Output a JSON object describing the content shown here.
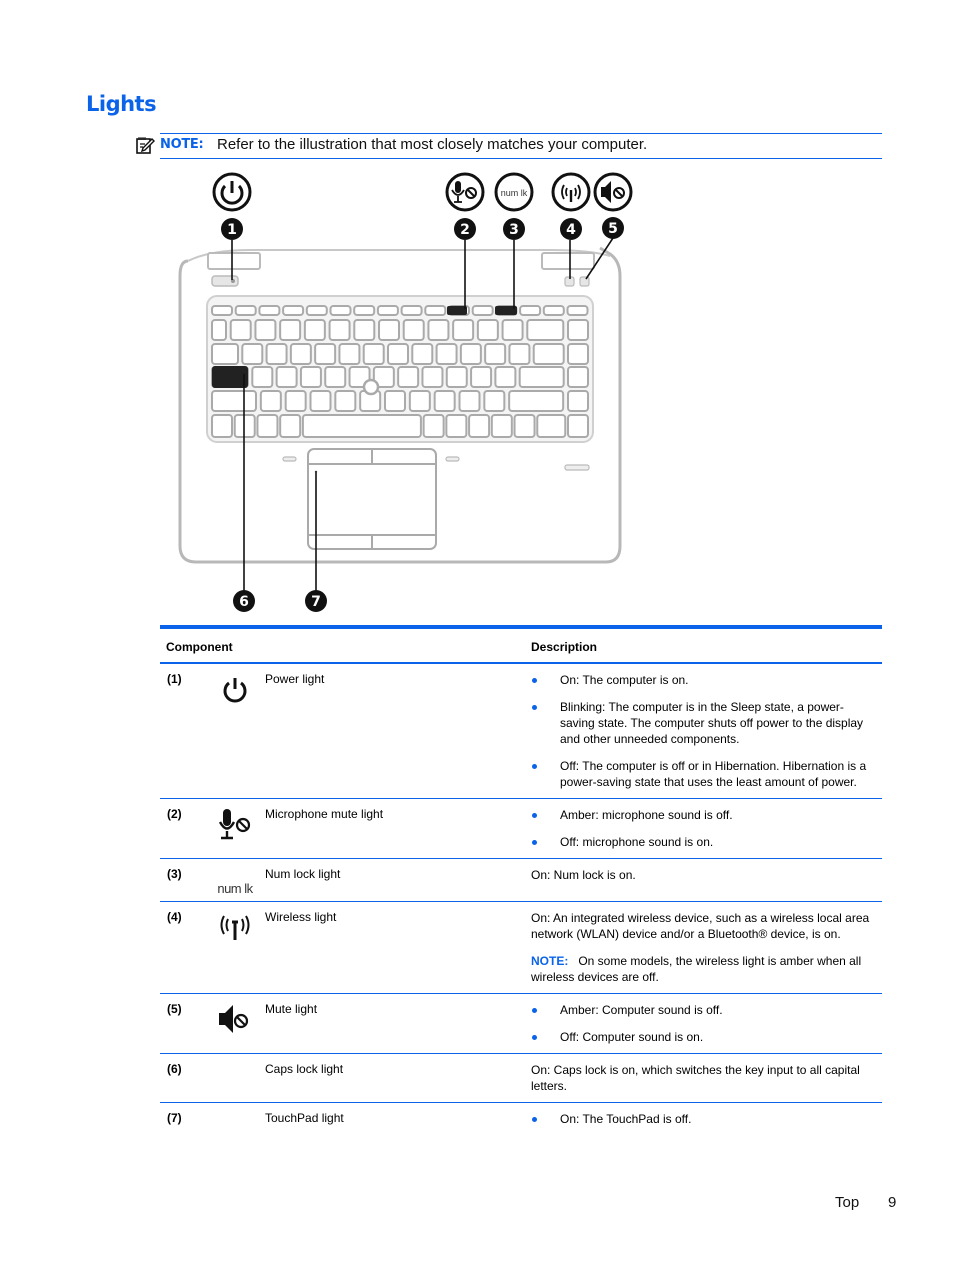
{
  "page": {
    "heading": "Lights",
    "note": {
      "icon": "note-pencil-icon",
      "label": "NOTE:",
      "text": "Refer to the illustration that most closely matches your computer."
    },
    "accent_color": "#0a63e8"
  },
  "illustration": {
    "callouts": [
      {
        "number": "1",
        "icon": "power-icon"
      },
      {
        "number": "2",
        "icon": "microphone-mute-icon"
      },
      {
        "number": "3",
        "icon": "num-lock-icon",
        "icon_text": "num lk"
      },
      {
        "number": "4",
        "icon": "wireless-icon"
      },
      {
        "number": "5",
        "icon": "speaker-mute-icon"
      },
      {
        "number": "6",
        "icon": ""
      },
      {
        "number": "7",
        "icon": ""
      }
    ]
  },
  "table": {
    "headers": {
      "component": "Component",
      "description": "Description"
    },
    "rows": [
      {
        "number": "(1)",
        "icon": "power-icon",
        "name": "Power light",
        "bullets": [
          "On: The computer is on.",
          "Blinking: The computer is in the Sleep state, a power-saving state. The computer shuts off power to the display and other unneeded components.",
          "Off: The computer is off or in Hibernation. Hibernation is a power-saving state that uses the least amount of power."
        ]
      },
      {
        "number": "(2)",
        "icon": "microphone-mute-icon",
        "name": "Microphone mute light",
        "bullets": [
          "Amber: microphone sound is off.",
          "Off: microphone sound is on."
        ]
      },
      {
        "number": "(3)",
        "icon": "num-lock-icon",
        "icon_text": "num lk",
        "name": "Num lock light",
        "text": "On: Num lock is on."
      },
      {
        "number": "(4)",
        "icon": "wireless-icon",
        "name": "Wireless light",
        "text": "On: An integrated wireless device, such as a wireless local area network (WLAN) device and/or a Bluetooth® device, is on.",
        "note_label": "NOTE:",
        "note_text": "On some models, the wireless light is amber when all wireless devices are off."
      },
      {
        "number": "(5)",
        "icon": "speaker-mute-icon",
        "name": "Mute light",
        "bullets": [
          "Amber: Computer sound is off.",
          "Off: Computer sound is on."
        ]
      },
      {
        "number": "(6)",
        "icon": "",
        "name": "Caps lock light",
        "text": "On: Caps lock is on, which switches the key input to all capital letters."
      },
      {
        "number": "(7)",
        "icon": "",
        "name": "TouchPad light",
        "bullets": [
          "On: The TouchPad is off."
        ]
      }
    ]
  },
  "footer": {
    "section": "Top",
    "page_number": "9"
  }
}
